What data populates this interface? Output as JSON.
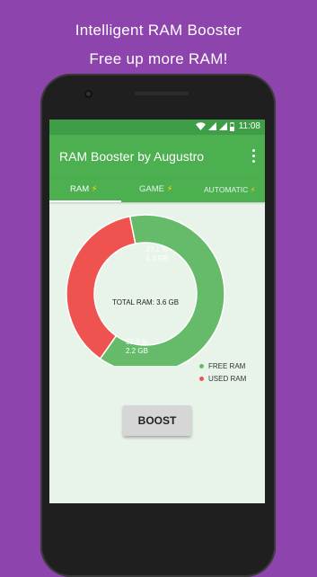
{
  "promo": {
    "line1": "Intelligent RAM Booster",
    "line2": "Free up more RAM!"
  },
  "status_bar": {
    "time": "11:08",
    "icons": [
      "wifi-icon",
      "signal-icon",
      "signal-icon",
      "battery-icon"
    ]
  },
  "app_bar": {
    "title": "RAM Booster by Augustro",
    "menu_icon": "overflow-menu-icon"
  },
  "tabs": [
    {
      "label": "RAM",
      "icon": "⚡",
      "selected": true
    },
    {
      "label": "GAME",
      "icon": "⚡",
      "selected": false
    },
    {
      "label": "AUTOMATIC",
      "icon": "⚡",
      "selected": false
    }
  ],
  "ram": {
    "total_label": "TOTAL RAM: 3.6 GB",
    "used": {
      "percent_text": "37.1 %",
      "size_text": "1.3 GB",
      "fraction": 0.371
    },
    "free": {
      "percent_text": "62.9 %",
      "size_text": "2.2 GB",
      "fraction": 0.629
    }
  },
  "legend": {
    "free_label": "FREE RAM",
    "used_label": "USED RAM"
  },
  "colors": {
    "free": "#66bb6a",
    "used": "#ef5350",
    "primary": "#4caf50",
    "background": "#8e44ad"
  },
  "boost_button": {
    "label": "BOOST"
  }
}
